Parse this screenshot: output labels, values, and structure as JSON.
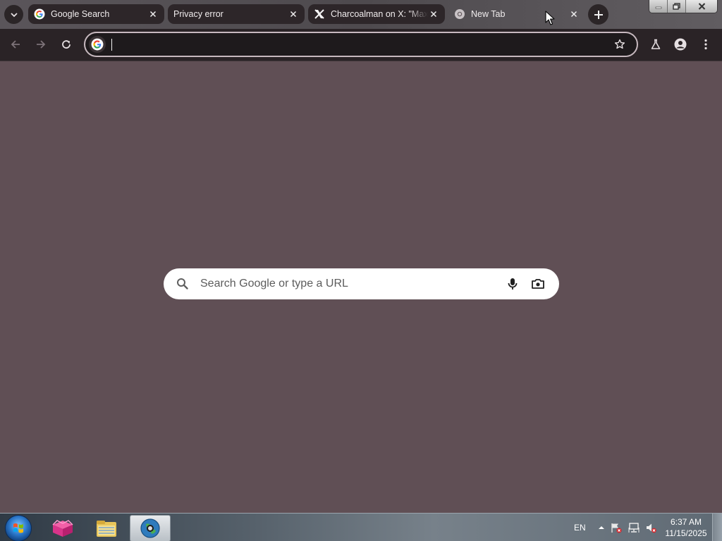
{
  "browser": {
    "tabs": [
      {
        "title": "Google Search",
        "favicon": "google-g-icon",
        "active": false
      },
      {
        "title": "Privacy error",
        "favicon": "none",
        "active": false
      },
      {
        "title": "Charcoalman on X: \"Max",
        "favicon": "x-logo-icon",
        "active": false
      },
      {
        "title": "New Tab",
        "favicon": "chrome-icon",
        "active": true
      }
    ],
    "omnibox": {
      "value": "",
      "placeholder": ""
    }
  },
  "ntp": {
    "search_placeholder": "Search Google or type a URL"
  },
  "taskbar": {
    "language": "EN",
    "time": "6:37 AM",
    "date": "11/15/2025"
  },
  "colors": {
    "page_background": "#604f55",
    "toolbar": "#2a2326",
    "tab_inactive": "#2d2629"
  }
}
